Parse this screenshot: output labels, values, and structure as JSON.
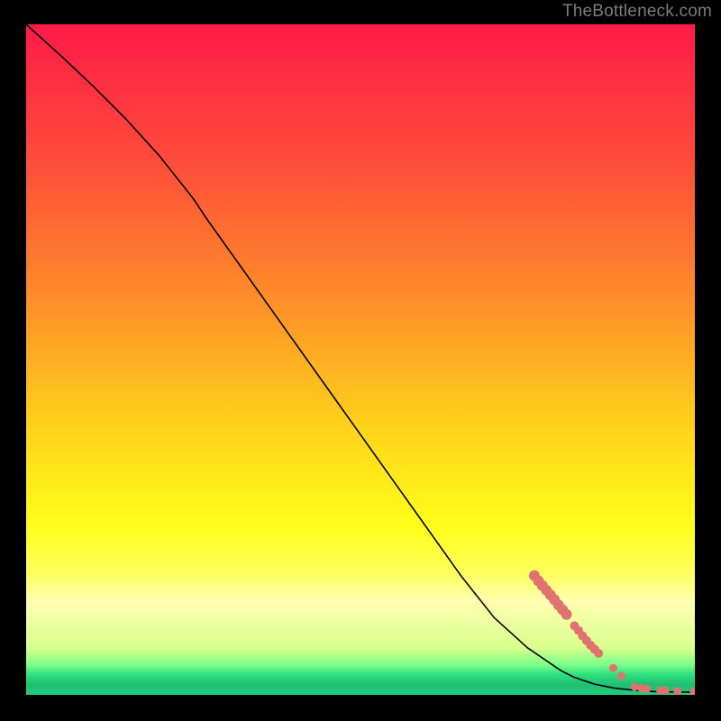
{
  "attribution": "TheBottleneck.com",
  "chart_data": {
    "type": "line",
    "title": "",
    "xlabel": "",
    "ylabel": "",
    "xlim": [
      0,
      100
    ],
    "ylim": [
      0,
      100
    ],
    "background_gradient": {
      "stops": [
        {
          "offset": 0.0,
          "color": "#ff1a48"
        },
        {
          "offset": 0.2,
          "color": "#ff4b3a"
        },
        {
          "offset": 0.4,
          "color": "#ff8a2a"
        },
        {
          "offset": 0.6,
          "color": "#ffd21a"
        },
        {
          "offset": 0.75,
          "color": "#ffff1a"
        },
        {
          "offset": 0.82,
          "color": "#ffff60"
        },
        {
          "offset": 0.86,
          "color": "#ffffb0"
        },
        {
          "offset": 0.93,
          "color": "#d8ff8c"
        },
        {
          "offset": 0.955,
          "color": "#7bff8a"
        },
        {
          "offset": 0.97,
          "color": "#2de07d"
        },
        {
          "offset": 0.985,
          "color": "#1fbf72"
        },
        {
          "offset": 1.0,
          "color": "#25cc7b"
        }
      ]
    },
    "series": [
      {
        "name": "curve",
        "color": "#000000",
        "width": 1.6,
        "x": [
          0,
          5,
          10,
          15,
          20,
          25,
          27,
          30,
          35,
          40,
          45,
          50,
          55,
          60,
          65,
          70,
          75,
          80,
          82,
          85,
          88,
          90,
          92,
          94,
          96,
          98,
          100
        ],
        "y": [
          100,
          95.5,
          90.8,
          85.8,
          80.3,
          74.0,
          71.0,
          66.8,
          59.8,
          52.8,
          45.8,
          38.8,
          31.8,
          24.8,
          17.8,
          11.5,
          7.0,
          3.6,
          2.6,
          1.6,
          1.0,
          0.8,
          0.6,
          0.5,
          0.45,
          0.42,
          0.4
        ]
      }
    ],
    "markers": {
      "name": "highlight-points",
      "color": "#e0736f",
      "points": [
        {
          "x": 76.0,
          "y": 17.8,
          "r": 6.0
        },
        {
          "x": 76.6,
          "y": 17.0,
          "r": 6.0
        },
        {
          "x": 77.2,
          "y": 16.3,
          "r": 6.0
        },
        {
          "x": 77.8,
          "y": 15.6,
          "r": 6.0
        },
        {
          "x": 78.4,
          "y": 14.9,
          "r": 6.0
        },
        {
          "x": 79.0,
          "y": 14.2,
          "r": 6.0
        },
        {
          "x": 79.6,
          "y": 13.4,
          "r": 6.0
        },
        {
          "x": 80.2,
          "y": 12.7,
          "r": 6.0
        },
        {
          "x": 80.8,
          "y": 12.0,
          "r": 6.0
        },
        {
          "x": 82.0,
          "y": 10.3,
          "r": 5.0
        },
        {
          "x": 82.6,
          "y": 9.6,
          "r": 5.0
        },
        {
          "x": 83.2,
          "y": 8.8,
          "r": 5.0
        },
        {
          "x": 83.8,
          "y": 8.1,
          "r": 5.0
        },
        {
          "x": 84.4,
          "y": 7.4,
          "r": 5.0
        },
        {
          "x": 85.0,
          "y": 6.8,
          "r": 5.0
        },
        {
          "x": 85.6,
          "y": 6.2,
          "r": 5.0
        },
        {
          "x": 87.8,
          "y": 4.0,
          "r": 4.5
        },
        {
          "x": 89.0,
          "y": 2.8,
          "r": 4.5
        },
        {
          "x": 91.0,
          "y": 1.2,
          "r": 4.5
        },
        {
          "x": 92.0,
          "y": 1.0,
          "r": 4.5
        },
        {
          "x": 92.8,
          "y": 0.9,
          "r": 4.5
        },
        {
          "x": 94.8,
          "y": 0.7,
          "r": 4.5
        },
        {
          "x": 95.6,
          "y": 0.65,
          "r": 4.5
        },
        {
          "x": 97.4,
          "y": 0.55,
          "r": 4.5
        },
        {
          "x": 100.0,
          "y": 0.4,
          "r": 5.5
        }
      ]
    }
  }
}
